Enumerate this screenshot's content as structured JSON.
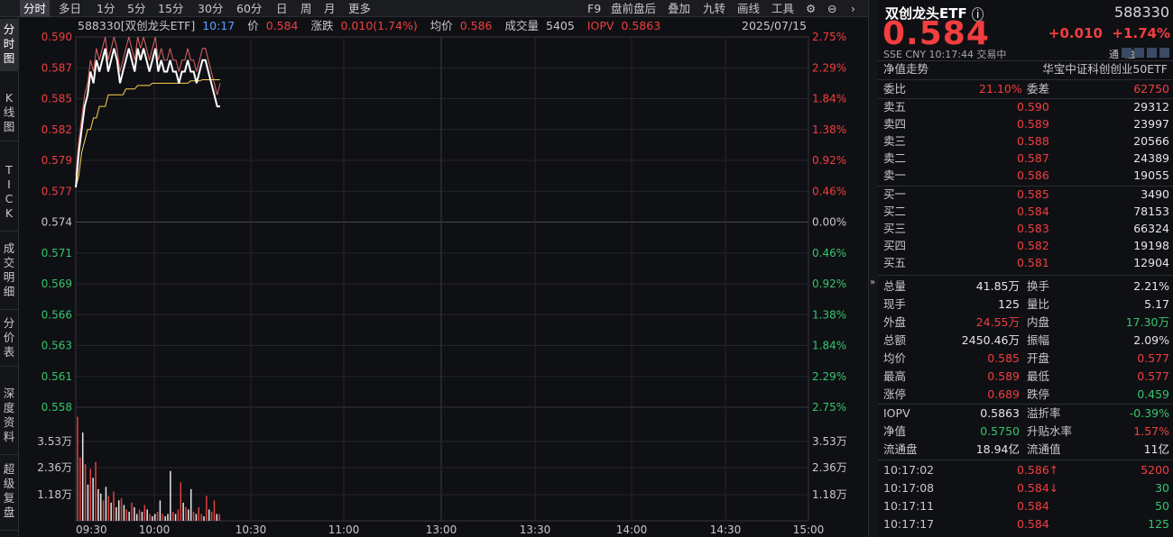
{
  "toolbar": {
    "tabs": [
      "分时",
      "多日",
      "1分",
      "5分",
      "15分",
      "30分",
      "60分",
      "日",
      "周",
      "月",
      "更多"
    ],
    "active_tab": "分时",
    "right_tools": [
      "F9",
      "盘前盘后",
      "叠加",
      "九转",
      "画线",
      "工具"
    ]
  },
  "left_tabs": [
    "分时图",
    "K线图",
    "TICK",
    "成交明细",
    "分价表",
    "深度资料",
    "超级复盘"
  ],
  "infobar": {
    "code_name": "588330[双创龙头ETF]",
    "time": "10:17",
    "price_label": "价",
    "price": "0.584",
    "change_label": "涨跌",
    "change": "0.010(1.74%)",
    "avg_label": "均价",
    "avg": "0.586",
    "volume_label": "成交量",
    "volume": "5405",
    "iopv_label": "IOPV",
    "iopv": "0.5863",
    "date": "2025/07/15"
  },
  "chart_data": {
    "type": "line",
    "prev_close": 0.574,
    "y_left_ticks": [
      "0.590",
      "0.587",
      "0.585",
      "0.582",
      "0.579",
      "0.577",
      "0.574",
      "0.571",
      "0.569",
      "0.566",
      "0.563",
      "0.561",
      "0.558"
    ],
    "y_right_ticks": [
      "2.75%",
      "2.29%",
      "1.84%",
      "1.38%",
      "0.92%",
      "0.46%",
      "0.00%",
      "0.46%",
      "0.92%",
      "1.38%",
      "1.84%",
      "2.29%",
      "2.75%"
    ],
    "x_ticks": [
      "09:30",
      "10:00",
      "10:30",
      "11:00",
      "13:00",
      "13:30",
      "14:00",
      "14:30",
      "15:00"
    ],
    "volume_ticks": [
      "3.53万",
      "2.36万",
      "1.18万"
    ],
    "ylim": [
      0.558,
      0.59
    ],
    "series": [
      {
        "color": "#ffffff",
        "values": [
          0.577,
          0.58,
          0.582,
          0.584,
          0.585,
          0.587,
          0.586,
          0.588,
          0.587,
          0.588,
          0.589,
          0.587,
          0.588,
          0.589,
          0.588,
          0.586,
          0.587,
          0.588,
          0.589,
          0.588,
          0.587,
          0.589,
          0.588,
          0.589,
          0.588,
          0.587,
          0.588,
          0.589,
          0.587,
          0.588,
          0.587,
          0.587,
          0.588,
          0.587,
          0.587,
          0.586,
          0.587,
          0.587,
          0.588,
          0.587,
          0.587,
          0.586,
          0.587,
          0.588,
          0.588,
          0.587,
          0.586,
          0.585,
          0.584,
          0.584
        ]
      },
      {
        "color": "#ffd24d",
        "values": [
          0.577,
          0.578,
          0.58,
          0.581,
          0.582,
          0.582,
          0.583,
          0.583,
          0.584,
          0.584,
          0.584,
          0.585,
          0.585,
          0.585,
          0.585,
          0.585,
          0.585,
          0.5855,
          0.5855,
          0.5855,
          0.5855,
          0.5858,
          0.5858,
          0.5858,
          0.5858,
          0.5858,
          0.586,
          0.586,
          0.586,
          0.586,
          0.586,
          0.586,
          0.586,
          0.586,
          0.586,
          0.586,
          0.586,
          0.586,
          0.586,
          0.5862,
          0.5862,
          0.5862,
          0.5862,
          0.5863,
          0.5863,
          0.5863,
          0.5863,
          0.5863,
          0.5863,
          0.5863
        ]
      },
      {
        "color": "#e06464",
        "values": [
          0.578,
          0.581,
          0.583,
          0.585,
          0.586,
          0.588,
          0.587,
          0.589,
          0.588,
          0.589,
          0.59,
          0.588,
          0.589,
          0.59,
          0.589,
          0.587,
          0.588,
          0.589,
          0.59,
          0.589,
          0.588,
          0.59,
          0.589,
          0.59,
          0.589,
          0.588,
          0.589,
          0.59,
          0.588,
          0.589,
          0.588,
          0.588,
          0.589,
          0.588,
          0.588,
          0.587,
          0.588,
          0.588,
          0.589,
          0.588,
          0.588,
          0.587,
          0.588,
          0.589,
          0.589,
          0.588,
          0.587,
          0.586,
          0.585,
          0.586
        ]
      }
    ],
    "volume_max": 4.7,
    "volumes": [
      4.6,
      2.8,
      3.9,
      2.5,
      1.6,
      2.3,
      1.9,
      2.6,
      1.4,
      1.2,
      0.9,
      1.5,
      1.1,
      0.8,
      1.3,
      0.6,
      0.9,
      1.0,
      0.7,
      0.5,
      0.4,
      0.8,
      0.6,
      0.3,
      0.5,
      0.4,
      0.7,
      0.5,
      0.3,
      0.2,
      0.3,
      0.4,
      0.9,
      0.3,
      0.2,
      0.3,
      2.2,
      0.4,
      0.3,
      0.5,
      1.7,
      0.8,
      0.6,
      0.5,
      1.4,
      0.4,
      0.3,
      0.6,
      0.3,
      0.2,
      1.1,
      0.5,
      0.4,
      0.9,
      0.3,
      0.3
    ],
    "volume_up": [
      1,
      1,
      0,
      1,
      0,
      1,
      0,
      1,
      0,
      0,
      1,
      0,
      1,
      0,
      1,
      0,
      0,
      1,
      0,
      1,
      0,
      1,
      0,
      0,
      1,
      0,
      1,
      0,
      1,
      0,
      0,
      1,
      0,
      1,
      0,
      0,
      0,
      1,
      0,
      1,
      1,
      0,
      1,
      0,
      0,
      1,
      0,
      1,
      1,
      0,
      1,
      0,
      1,
      1,
      0,
      1
    ]
  },
  "quote": {
    "name": "双创龙头ETF",
    "code": "588330",
    "price": "0.584",
    "change": "+0.010",
    "change_pct": "+1.74%",
    "meta": "SSE  CNY  10:17:44  交易中",
    "tags": "通  融",
    "nav_label": "净值走势",
    "index_name": "华宝中证科创创业50ETF",
    "weibi_label": "委比",
    "weibi": "21.10%",
    "weicha_label": "委差",
    "weicha": "62750",
    "asks": [
      {
        "label": "卖五",
        "price": "0.590",
        "vol": "29312"
      },
      {
        "label": "卖四",
        "price": "0.589",
        "vol": "23997"
      },
      {
        "label": "卖三",
        "price": "0.588",
        "vol": "20566"
      },
      {
        "label": "卖二",
        "price": "0.587",
        "vol": "24389"
      },
      {
        "label": "卖一",
        "price": "0.586",
        "vol": "19055"
      }
    ],
    "bids": [
      {
        "label": "买一",
        "price": "0.585",
        "vol": "3490"
      },
      {
        "label": "买二",
        "price": "0.584",
        "vol": "78153"
      },
      {
        "label": "买三",
        "price": "0.583",
        "vol": "66324"
      },
      {
        "label": "买四",
        "price": "0.582",
        "vol": "19198"
      },
      {
        "label": "买五",
        "price": "0.581",
        "vol": "12904"
      }
    ],
    "stats": [
      {
        "l1": "总量",
        "v1": "41.85万",
        "c1": "white",
        "l2": "换手",
        "v2": "2.21%",
        "c2": "white"
      },
      {
        "l1": "现手",
        "v1": "125",
        "c1": "white",
        "l2": "量比",
        "v2": "5.17",
        "c2": "white"
      },
      {
        "l1": "外盘",
        "v1": "24.55万",
        "c1": "red",
        "l2": "内盘",
        "v2": "17.30万",
        "c2": "green"
      },
      {
        "l1": "总额",
        "v1": "2450.46万",
        "c1": "white",
        "l2": "振幅",
        "v2": "2.09%",
        "c2": "white"
      },
      {
        "l1": "均价",
        "v1": "0.585",
        "c1": "red",
        "l2": "开盘",
        "v2": "0.577",
        "c2": "red"
      },
      {
        "l1": "最高",
        "v1": "0.589",
        "c1": "red",
        "l2": "最低",
        "v2": "0.577",
        "c2": "red"
      },
      {
        "l1": "涨停",
        "v1": "0.689",
        "c1": "red",
        "l2": "跌停",
        "v2": "0.459",
        "c2": "green"
      }
    ],
    "stats2": [
      {
        "l1": "IOPV",
        "v1": "0.5863",
        "c1": "white",
        "l2": "溢折率",
        "v2": "-0.39%",
        "c2": "green"
      },
      {
        "l1": "净值",
        "v1": "0.5750",
        "c1": "green",
        "l2": "升贴水率",
        "v2": "1.57%",
        "c2": "red"
      },
      {
        "l1": "流通盘",
        "v1": "18.94亿",
        "c1": "white",
        "l2": "流通值",
        "v2": "11亿",
        "c2": "white"
      }
    ],
    "ticks": [
      {
        "time": "10:17:02",
        "price": "0.586",
        "arrow": "↑",
        "vol": "5200",
        "vc": "red"
      },
      {
        "time": "10:17:08",
        "price": "0.584",
        "arrow": "↓",
        "vol": "30",
        "vc": "green"
      },
      {
        "time": "10:17:11",
        "price": "0.584",
        "arrow": "",
        "vol": "50",
        "vc": "green"
      },
      {
        "time": "10:17:17",
        "price": "0.584",
        "arrow": "",
        "vol": "125",
        "vc": "green"
      }
    ]
  }
}
